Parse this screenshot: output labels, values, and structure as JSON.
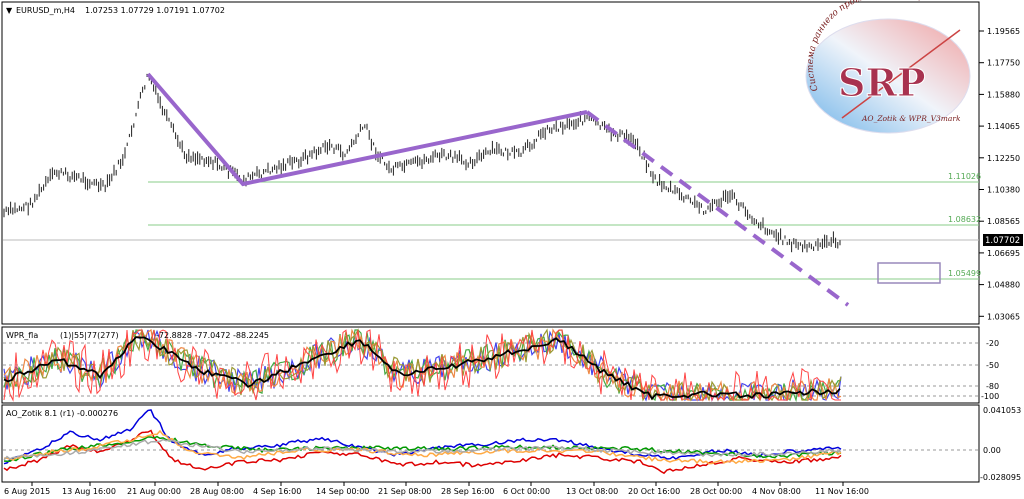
{
  "main": {
    "symbol_label": "EURUSD_m,H4",
    "ohlc": "1.07253 1.07729 1.07191 1.07702",
    "price_scale": [
      "1.19565",
      "1.17750",
      "1.15880",
      "1.14065",
      "1.12250",
      "1.10380",
      "1.08565",
      "1.06695",
      "1.04880",
      "1.03065"
    ],
    "current_price": "1.07702",
    "fib_levels": [
      "1.11026",
      "1.08632",
      "1.05499"
    ],
    "colors": {
      "trendline": "#9966cc",
      "fib": "#88cc88",
      "candles": "#000000"
    }
  },
  "wpr": {
    "label_parts": [
      "WPR_fla",
      "(1)|55|77(277)",
      "-72.8828 -77.0472 -88.2245"
    ],
    "levels": [
      "-20",
      "-50",
      "-80",
      "-100"
    ]
  },
  "ao": {
    "label": "AO_Zotik 8.1 (r1) -0.000276",
    "levels": [
      "0.041053",
      "0.00",
      "-0.028095"
    ]
  },
  "time_axis": [
    "6 Aug 2015",
    "13 Aug 16:00",
    "21 Aug 00:00",
    "28 Aug 08:00",
    "4 Sep 16:00",
    "14 Sep 00:00",
    "21 Sep 08:00",
    "28 Sep 16:00",
    "6 Oct 00:00",
    "13 Oct 08:00",
    "20 Oct 16:00",
    "28 Oct 00:00",
    "4 Nov 08:00",
    "11 Nov 16:00"
  ],
  "logo": {
    "letters": "SRP",
    "ring_text": "Система раннего прогнозирования",
    "footer": "AO_Zotik & WPR_V3mark"
  }
}
